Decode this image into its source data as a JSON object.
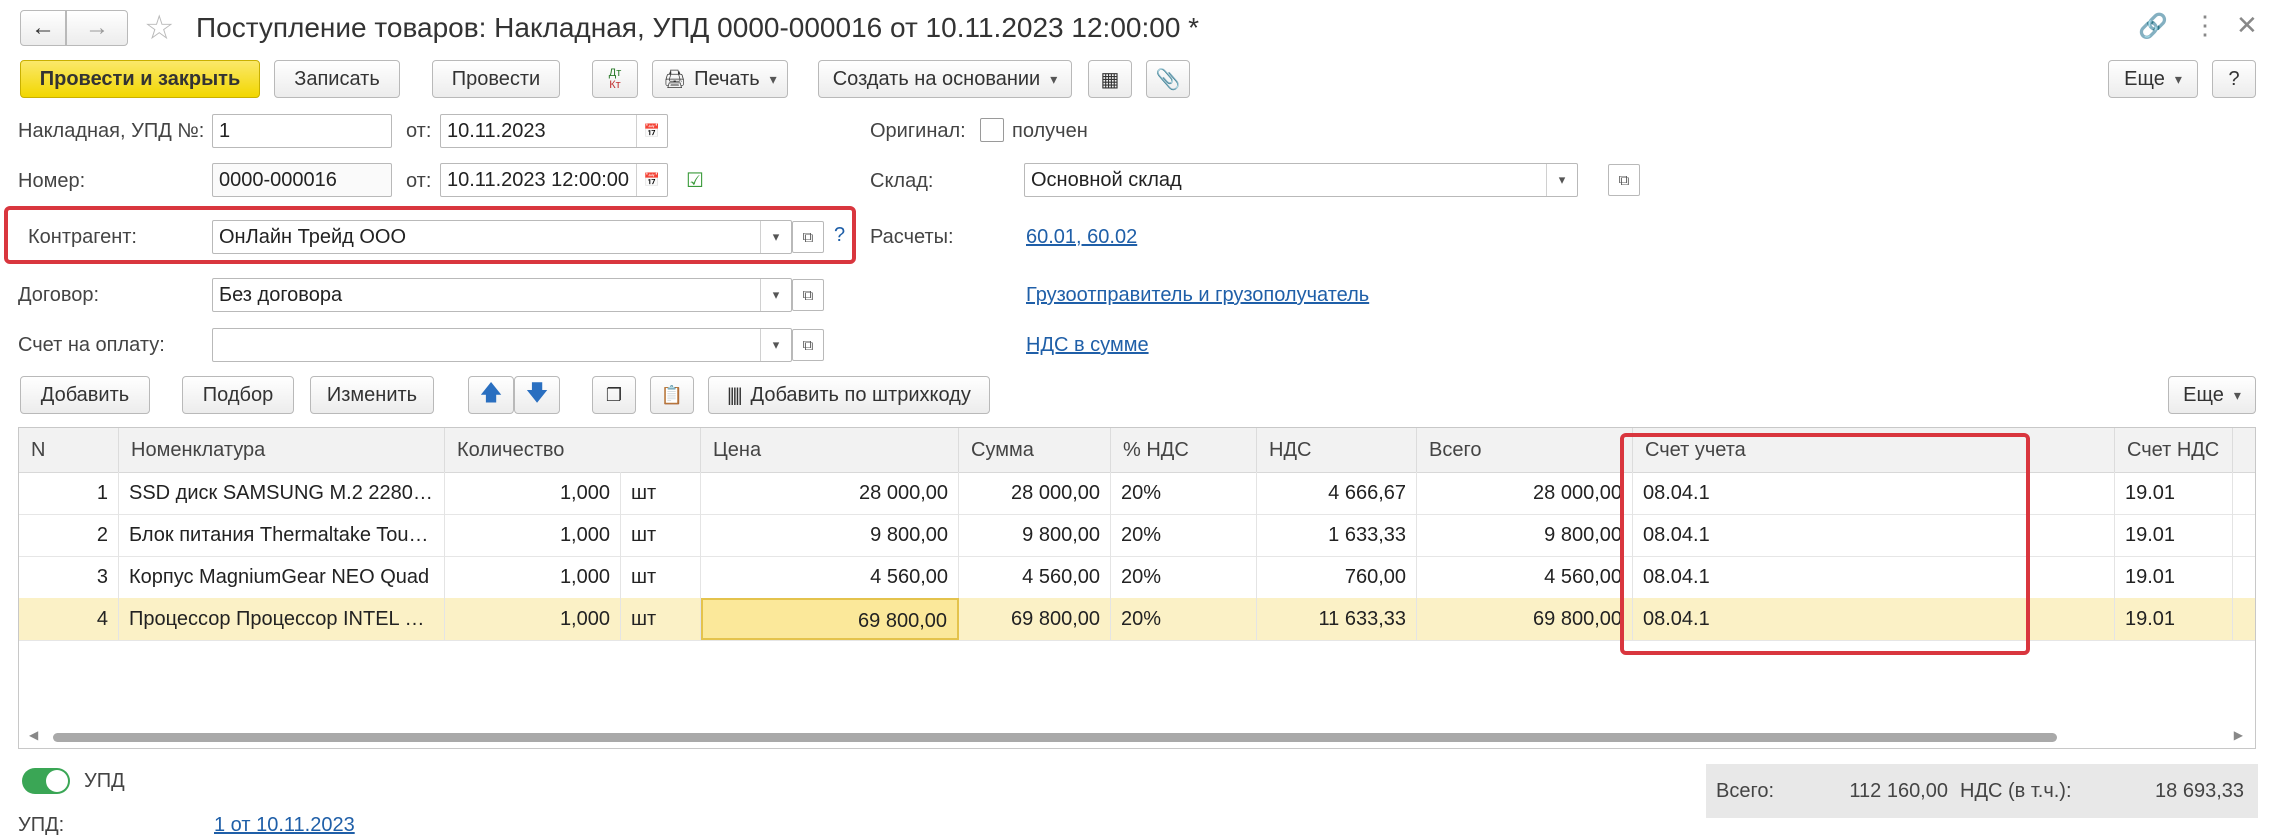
{
  "window": {
    "title": "Поступление товаров: Накладная, УПД 0000-000016 от 10.11.2023 12:00:00 *",
    "icons": [
      "back-arrow-icon",
      "forward-arrow-icon",
      "star-icon",
      "link-icon",
      "more-vertical-icon",
      "close-icon"
    ]
  },
  "toolbar": {
    "post_close": "Провести и закрыть",
    "save": "Записать",
    "post": "Провести",
    "dtkt_top": "Дт",
    "dtkt_bottom": "Кт",
    "print": "Печать",
    "create_based": "Создать на основании",
    "more": "Еще",
    "help": "?"
  },
  "header": {
    "invoice_label": "Накладная, УПД №:",
    "invoice_value": "1",
    "from_label": "от:",
    "invoice_date": "10.11.2023",
    "number_label": "Номер:",
    "number_value": "0000-000016",
    "number_from_label": "от:",
    "number_date": "10.11.2023 12:00:00",
    "original_label": "Оригинал:",
    "original_checkbox": "получен",
    "original_checked": false,
    "warehouse_label": "Склад:",
    "warehouse_value": "Основной склад",
    "counterparty_label": "Контрагент:",
    "counterparty_value": "ОнЛайн Трейд ООО",
    "counterparty_help": "?",
    "settlements_label": "Расчеты:",
    "settlements_link": "60.01, 60.02",
    "contract_label": "Договор:",
    "contract_value": "Без договора",
    "shipper_link": "Грузоотправитель и грузополучатель",
    "payment_invoice_label": "Счет на оплату:",
    "payment_invoice_value": "",
    "vat_link": "НДС в сумме"
  },
  "table_toolbar": {
    "add": "Добавить",
    "pick": "Подбор",
    "edit": "Изменить",
    "add_barcode": "Добавить по штрихкоду",
    "more": "Еще"
  },
  "table": {
    "columns": [
      "N",
      "Номенклатура",
      "Количество",
      "Цена",
      "Сумма",
      "% НДС",
      "НДС",
      "Всего",
      "Счет учета",
      "Счет НДС"
    ],
    "rows": [
      {
        "n": "1",
        "name": "SSD диск SAMSUNG M.2 2280 ...",
        "qty": "1,000",
        "unit": "шт",
        "price": "28 000,00",
        "sum": "28 000,00",
        "vat_rate": "20%",
        "vat": "4 666,67",
        "total": "28 000,00",
        "account": "08.04.1",
        "vat_account": "19.01"
      },
      {
        "n": "2",
        "name": "Блок питания Thermaltake Toughpower",
        "qty": "1,000",
        "unit": "шт",
        "price": "9 800,00",
        "sum": "9 800,00",
        "vat_rate": "20%",
        "vat": "1 633,33",
        "total": "9 800,00",
        "account": "08.04.1",
        "vat_account": "19.01"
      },
      {
        "n": "3",
        "name": "Корпус MagniumGear NEO Quad",
        "qty": "1,000",
        "unit": "шт",
        "price": "4 560,00",
        "sum": "4 560,00",
        "vat_rate": "20%",
        "vat": "760,00",
        "total": "4 560,00",
        "account": "08.04.1",
        "vat_account": "19.01"
      },
      {
        "n": "4",
        "name": "Процессор Процессор INTEL Core",
        "qty": "1,000",
        "unit": "шт",
        "price": "69 800,00",
        "sum": "69 800,00",
        "vat_rate": "20%",
        "vat": "11 633,33",
        "total": "69 800,00",
        "account": "08.04.1",
        "vat_account": "19.01"
      }
    ],
    "selected_row": 4
  },
  "footer": {
    "upd_toggle_label": "УПД",
    "upd_toggle_on": true,
    "upd_label": "УПД:",
    "upd_link": "1 от 10.11.2023",
    "total_label": "Всего:",
    "total_value": "112 160,00",
    "vat_label": "НДС (в т.ч.):",
    "vat_value": "18 693,33"
  },
  "colors": {
    "primary_button": "#f2d700",
    "highlight_box": "#d9363e",
    "link": "#1f5fa8",
    "selected_row": "#fbf1c6",
    "toggle_on": "#3aa655"
  }
}
